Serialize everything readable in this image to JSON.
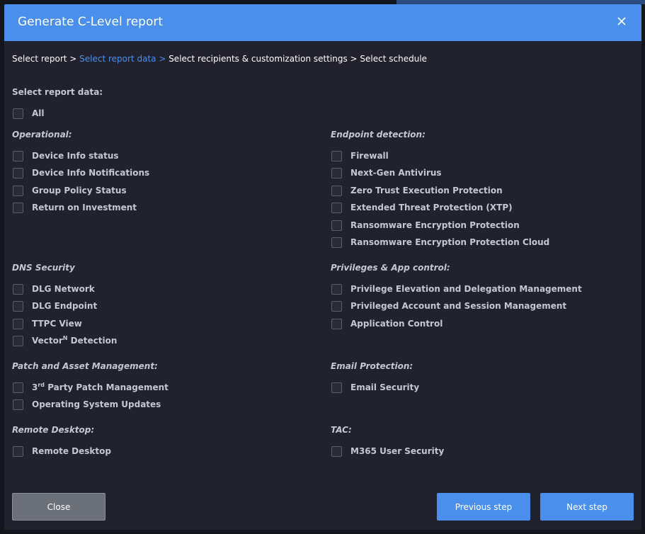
{
  "dialog": {
    "title": "Generate C-Level report",
    "close_icon": "close-icon"
  },
  "breadcrumb": {
    "step1": "Select report",
    "sep1": " > ",
    "step2": "Select report data",
    "sep2": " > ",
    "step3": "Select recipients & customization settings",
    "sep3": " > ",
    "step4": "Select schedule"
  },
  "section_title": "Select report data:",
  "all_label": "All",
  "groups": {
    "operational": {
      "title": "Operational:",
      "items": [
        "Device Info status",
        "Device Info Notifications",
        "Group Policy Status",
        "Return on Investment"
      ]
    },
    "endpoint": {
      "title": "Endpoint detection:",
      "items": [
        "Firewall",
        "Next-Gen Antivirus",
        "Zero Trust Execution Protection",
        "Extended Threat Protection (XTP)",
        "Ransomware Encryption Protection",
        "Ransomware Encryption Protection Cloud"
      ]
    },
    "dns": {
      "title": "DNS Security",
      "items": [
        "DLG Network",
        "DLG Endpoint",
        "TTPC View"
      ],
      "vector_base": "Vector",
      "vector_sup": "N",
      "vector_rest": " Detection"
    },
    "privileges": {
      "title": "Privileges & App control:",
      "items": [
        "Privilege Elevation and Delegation Management",
        "Privileged Account and Session Management",
        "Application Control"
      ]
    },
    "patch": {
      "title": "Patch and Asset Management:",
      "third_base": "3",
      "third_sup": "rd",
      "third_rest": " Party Patch Management",
      "items": [
        "Operating System Updates"
      ]
    },
    "email": {
      "title": "Email Protection:",
      "items": [
        "Email Security"
      ]
    },
    "remote": {
      "title": "Remote Desktop:",
      "items": [
        "Remote Desktop"
      ]
    },
    "tac": {
      "title": "TAC:",
      "items": [
        "M365 User Security"
      ]
    }
  },
  "buttons": {
    "close": "Close",
    "previous": "Previous step",
    "next": "Next step"
  },
  "colors": {
    "accent": "#4a8fec",
    "dialog_bg": "#21222e",
    "close_button": "#6c7079"
  }
}
